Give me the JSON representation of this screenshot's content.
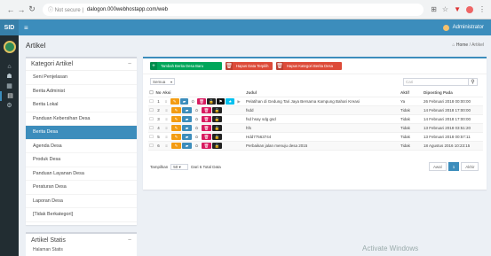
{
  "browser": {
    "secure_label": "Not secure",
    "url": "dalogon.000webhostapp.com/web"
  },
  "app": {
    "brand": "SID",
    "user": "Administrator"
  },
  "page": {
    "title": "Artikel",
    "breadcrumb_home": "Home",
    "breadcrumb_current": "Artikel"
  },
  "categories": {
    "title": "Kategori Artikel",
    "items": [
      "Seni Penjelasan",
      "Berita Administ",
      "Berita Lokal",
      "Panduan Kebersihan Desa",
      "Berita Desa",
      "Agenda Desa",
      "Produk Desa",
      "Panduan Layanan Desa",
      "Peraturan Desa",
      "Laporan Desa",
      "[Tidak Berkategori]"
    ],
    "active_index": 4
  },
  "statis": {
    "title": "Artikel Statis",
    "items": [
      "Halaman Statis"
    ]
  },
  "toolbar": {
    "add_label": "Tambah Berita Desa Baru",
    "delete_label": "Hapus Data Terpilih",
    "delete_cat_label": "Hapus Kategori Berita Desa"
  },
  "filter": {
    "value": "Semua"
  },
  "search": {
    "placeholder": "Cari"
  },
  "table": {
    "headers": {
      "no": "No",
      "aksi": "Aksi",
      "judul": "Judul",
      "aktif": "Aktif",
      "diposting": "Diposting Pada"
    },
    "rows": [
      {
        "no": "1",
        "judul": "Pelatihan di Gedung Tari Jaya Bersama Kampung Bahari Kreasi",
        "aktif": "Ya",
        "diposting": "26 Februari 2018 00:00:00"
      },
      {
        "no": "2",
        "judul": "fsdd",
        "aktif": "Tidak",
        "diposting": "14 Februari 2018 17:00:00"
      },
      {
        "no": "3",
        "judul": "fsd hsay sdg gsd",
        "aktif": "Tidak",
        "diposting": "14 Februari 2018 17:00:00"
      },
      {
        "no": "4",
        "judul": "hfs",
        "aktif": "Tidak",
        "diposting": "13 Februari 2018 03:51:20"
      },
      {
        "no": "5",
        "judul": "Hdd77563744",
        "aktif": "Tidak",
        "diposting": "13 Februari 2018 00:57:11"
      },
      {
        "no": "6",
        "judul": "Perbaikan jalan menuju desa 2015",
        "aktif": "Tidak",
        "diposting": "18 Agustus 2016 10:23:15"
      }
    ]
  },
  "footer": {
    "tampilkan": "Tampilkan",
    "per_page": "50",
    "dari": "Dari 6 Total Data",
    "prev": "Awal",
    "page": "1",
    "next": "Akhir"
  },
  "watermark": "Activate Windows"
}
